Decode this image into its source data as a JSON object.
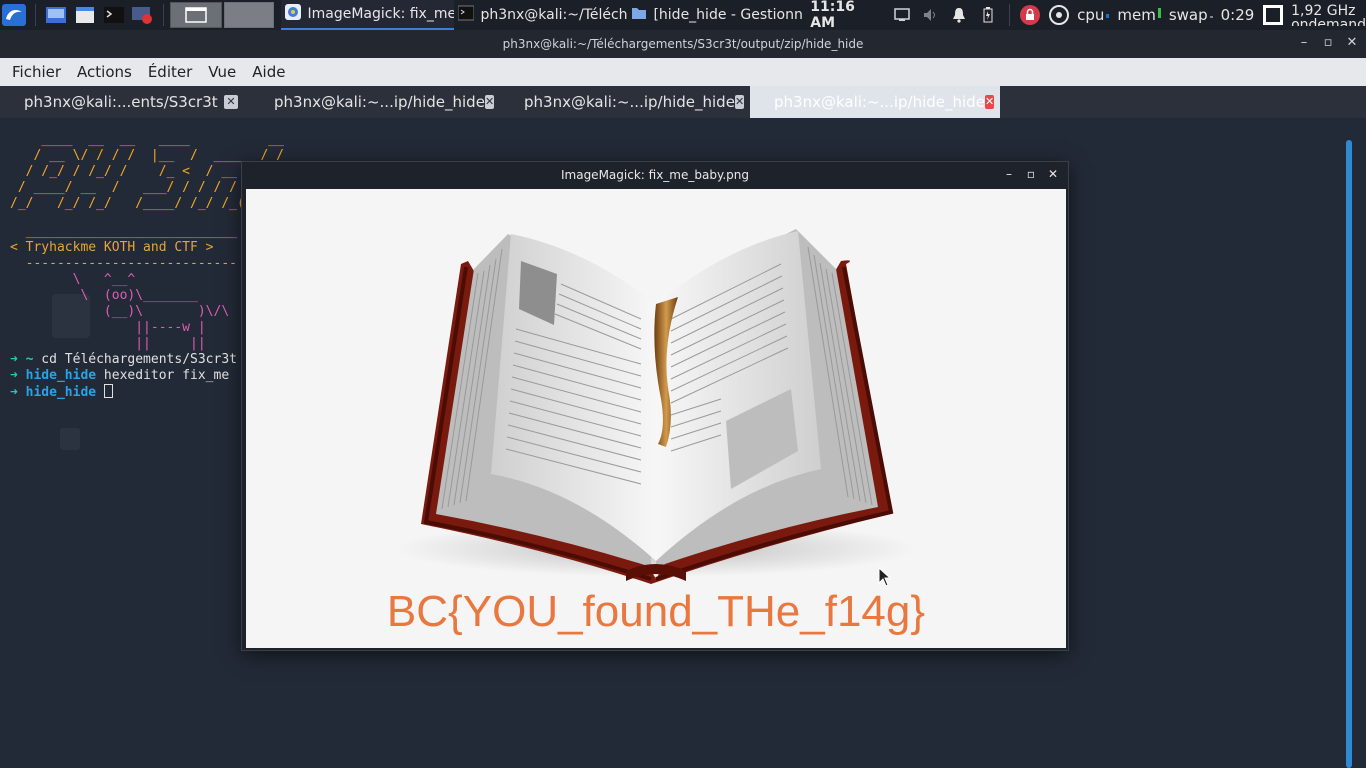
{
  "panel": {
    "desktop_icon": "kali-dragon-icon",
    "tasks": [
      {
        "label": "ImageMagick: fix_me...",
        "icon": "imagemagick-icon",
        "active": true
      },
      {
        "label": "ph3nx@kali:~/Téléch...",
        "icon": "terminal-icon",
        "active": false
      },
      {
        "label": "[hide_hide - Gestionn...",
        "icon": "folder-icon",
        "active": false
      }
    ],
    "clock": "11:16 AM",
    "monitors": {
      "cpu": "cpu",
      "mem": "mem",
      "swap": "swap"
    },
    "uptime": "0:29",
    "cpu_freq": "1,92 GHz",
    "cpu_gov": "ondemand"
  },
  "terminal": {
    "title": "ph3nx@kali:~/Téléchargements/S3cr3t/output/zip/hide_hide",
    "menu": {
      "file": "Fichier",
      "actions": "Actions",
      "edit": "Éditer",
      "view": "Vue",
      "help": "Aide"
    },
    "tabs": [
      {
        "label": "ph3nx@kali:...ents/S3cr3t"
      },
      {
        "label": "ph3nx@kali:~...ip/hide_hide"
      },
      {
        "label": "ph3nx@kali:~...ip/hide_hide"
      },
      {
        "label": "ph3nx@kali:~...ip/hide_hide"
      }
    ],
    "banner_ascii": "    ____  __  __   ____          __\n   / __ \\/ / / /  |__  /  ____  / /\n  / /_/ / /_/ /    /_ <  / __ \\/ / \n / ____/ __  /   ___/ / / / / /_/  \n/_/   /_/ /_/   /____/ /_/ /_(_)   ",
    "koth_line": "  ___________________________\n< Tryhackme KOTH and CTF >\n  ---------------------------",
    "cow_ascii": "        \\   ^__^\n         \\  (oo)\\_______\n            (__)\\       )\\/\\\n                ||----w |\n                ||     ||",
    "lines": [
      {
        "arrow": "➜",
        "dir": "~",
        "cmd": " cd Téléchargements/S3cr3t"
      },
      {
        "arrow": "➜",
        "dir": "hide_hide",
        "cmd": " hexeditor fix_me"
      },
      {
        "arrow": "➜",
        "dir": "hide_hide",
        "cmd": " "
      }
    ]
  },
  "imagemagick": {
    "title": "ImageMagick: fix_me_baby.png",
    "flag_text": "BC{YOU_found_THe_f14g}"
  }
}
